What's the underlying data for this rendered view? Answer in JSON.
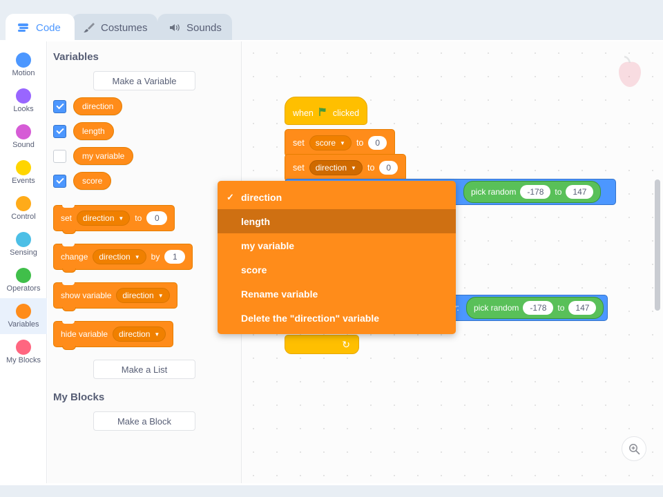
{
  "tabs": [
    {
      "label": "Code",
      "icon": "code-blocks-icon",
      "active": true
    },
    {
      "label": "Costumes",
      "icon": "paintbrush-icon",
      "active": false
    },
    {
      "label": "Sounds",
      "icon": "speaker-icon",
      "active": false
    }
  ],
  "categories": [
    {
      "label": "Motion",
      "color": "#4c97ff"
    },
    {
      "label": "Looks",
      "color": "#9966ff"
    },
    {
      "label": "Sound",
      "color": "#d65cd6"
    },
    {
      "label": "Events",
      "color": "#ffd500"
    },
    {
      "label": "Control",
      "color": "#ffab19"
    },
    {
      "label": "Sensing",
      "color": "#4cbfe6"
    },
    {
      "label": "Operators",
      "color": "#40bf4a"
    },
    {
      "label": "Variables",
      "color": "#ff8c1a"
    },
    {
      "label": "My Blocks",
      "color": "#ff6680"
    }
  ],
  "selected_category": "Variables",
  "palette": {
    "variables_heading": "Variables",
    "make_variable_label": "Make a Variable",
    "variables": [
      {
        "name": "direction",
        "checked": true
      },
      {
        "name": "length",
        "checked": true
      },
      {
        "name": "my variable",
        "checked": false
      },
      {
        "name": "score",
        "checked": true
      }
    ],
    "blocks": {
      "set_label": "set",
      "set_to": "to",
      "set_value": "0",
      "set_var": "direction",
      "change_label": "change",
      "change_by": "by",
      "change_value": "1",
      "change_var": "direction",
      "show_variable_label": "show variable",
      "show_var": "direction",
      "hide_variable_label": "hide variable",
      "hide_var": "direction"
    },
    "make_list_label": "Make a List",
    "my_blocks_heading": "My Blocks",
    "make_block_label": "Make a Block"
  },
  "script": {
    "hat": {
      "when": "when",
      "clicked": "clicked",
      "flag": "green-flag-icon"
    },
    "set_score": {
      "set": "set",
      "var": "score",
      "to": "to",
      "value": "0"
    },
    "set_direction": {
      "set": "set",
      "var": "direction",
      "to": "to",
      "value": "0"
    },
    "pick_random_top": {
      "label": "pick random",
      "from": "-178",
      "to_label": "to",
      "to": "147"
    },
    "goto_bottom": {
      "y_label": "y:",
      "pick_label": "pick random",
      "from": "-178",
      "to_label": "to",
      "to": "147"
    }
  },
  "dropdown_menu": {
    "items": [
      {
        "label": "direction",
        "checked": true,
        "highlighted": false
      },
      {
        "label": "length",
        "checked": false,
        "highlighted": true
      },
      {
        "label": "my variable",
        "checked": false,
        "highlighted": false
      },
      {
        "label": "score",
        "checked": false,
        "highlighted": false
      },
      {
        "label": "Rename variable",
        "checked": false,
        "highlighted": false
      },
      {
        "label": "Delete the \"direction\" variable",
        "checked": false,
        "highlighted": false
      }
    ]
  },
  "canvas": {
    "zoom_in_icon": "zoom-in-icon",
    "sprite_watermark": "apple-sprite-icon"
  },
  "colors": {
    "variables": "#ff8c1a",
    "events": "#ffbf00",
    "motion": "#4c97ff",
    "operators": "#59c059",
    "accent": "#4c97ff",
    "menu_highlight": "#cf7012"
  }
}
